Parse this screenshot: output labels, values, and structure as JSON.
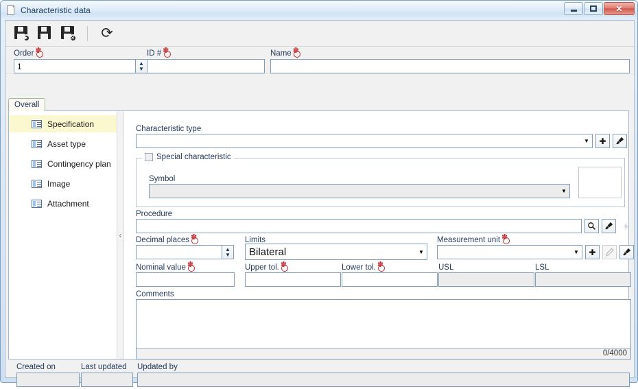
{
  "window": {
    "title": "Characteristic data",
    "title_icon": "document-icon",
    "caption": {
      "minimize": "minimize-icon",
      "maximize": "restore-icon",
      "close": "✕"
    }
  },
  "toolbar": {
    "buttons": [
      {
        "name": "save-and-new-button",
        "icon": "floppy-save-new-icon",
        "badge": "▶"
      },
      {
        "name": "save-button",
        "icon": "floppy-save-icon",
        "badge": ""
      },
      {
        "name": "save-and-close-button",
        "icon": "floppy-save-close-icon",
        "badge": "✕"
      },
      {
        "name": "refresh-button",
        "icon": "refresh-icon",
        "badge": "⟳"
      }
    ]
  },
  "header": {
    "order": {
      "label": "Order",
      "required": true,
      "value": "1"
    },
    "id": {
      "label": "ID #",
      "required": true,
      "value": ""
    },
    "name": {
      "label": "Name",
      "required": true,
      "value": ""
    }
  },
  "tabs": [
    {
      "label": "Overall",
      "selected": true
    }
  ],
  "sidebar": {
    "items": [
      {
        "label": "Specification",
        "icon": "form-icon",
        "selected": true
      },
      {
        "label": "Asset type",
        "icon": "form-icon",
        "selected": false
      },
      {
        "label": "Contingency plan",
        "icon": "form-icon",
        "selected": false
      },
      {
        "label": "Image",
        "icon": "form-icon",
        "selected": false
      },
      {
        "label": "Attachment",
        "icon": "form-icon",
        "selected": false
      }
    ],
    "collapse_glyph": "‹"
  },
  "form": {
    "characteristic_type": {
      "label": "Characteristic type",
      "value": "",
      "arrow": "▼",
      "add_button": "✚",
      "clear_button": "brush-icon"
    },
    "special_characteristic": {
      "title": "Special characteristic",
      "checked": false,
      "symbol": {
        "label": "Symbol",
        "value": "",
        "arrow": "▼",
        "disabled": true
      },
      "preview": ""
    },
    "procedure": {
      "label": "Procedure",
      "value": "",
      "search_button": "magnifier-icon",
      "clear_button": "brush-icon",
      "lightning_button": "lightning-icon"
    },
    "decimal_places": {
      "label": "Decimal places",
      "required": true,
      "value": ""
    },
    "limits": {
      "label": "Limits",
      "value": "Bilateral",
      "arrow": "▼"
    },
    "measurement_unit": {
      "label": "Measurement unit",
      "required": true,
      "value": "",
      "arrow": "▼",
      "add_button": "✚",
      "edit_button": "pencil-icon",
      "clear_button": "brush-icon"
    },
    "nominal_value": {
      "label": "Nominal value",
      "required": true,
      "value": ""
    },
    "upper_tol": {
      "label": "Upper tol.",
      "required": true,
      "value": ""
    },
    "lower_tol": {
      "label": "Lower tol.",
      "required": true,
      "value": ""
    },
    "usl": {
      "label": "USL",
      "value": "",
      "disabled": true
    },
    "lsl": {
      "label": "LSL",
      "value": "",
      "disabled": true
    },
    "comments": {
      "label": "Comments",
      "value": "",
      "counter": "0/4000"
    }
  },
  "footer": {
    "created_on": {
      "label": "Created on",
      "value": "",
      "disabled": true
    },
    "last_updated": {
      "label": "Last updated",
      "value": "",
      "disabled": true
    },
    "updated_by": {
      "label": "Updated by",
      "value": "",
      "disabled": true
    }
  }
}
